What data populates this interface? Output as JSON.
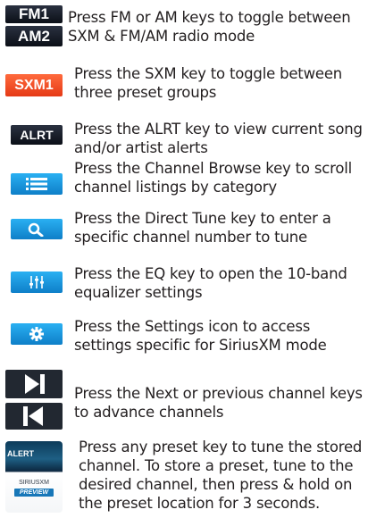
{
  "rows": [
    {
      "text": "Press FM or AM keys to toggle between SXM & FM/AM radio mode",
      "keys": [
        "FM1",
        "AM2"
      ]
    },
    {
      "text": "Press the SXM key to toggle between three preset groups",
      "keys": [
        "SXM1"
      ]
    },
    {
      "text": "Press the ALRT key to view current song and/or artist alerts",
      "keys": [
        "ALRT"
      ]
    },
    {
      "text": "Press the Channel Browse key to scroll channel listings by category",
      "icon": "list-icon"
    },
    {
      "text": "Press the Direct Tune key to enter a specific channel number to tune",
      "icon": "search-icon"
    },
    {
      "text": "Press the EQ key to open the 10-band equalizer settings",
      "icon": "equalizer-icon"
    },
    {
      "text": "Press the Settings icon to access settings specific for SiriusXM mode",
      "icon": "gear-icon"
    },
    {
      "text": "Press the Next or previous channel keys to advance channels",
      "icons": [
        "next-track-icon",
        "previous-track-icon"
      ]
    },
    {
      "text": "Press any preset key to tune the stored channel. To store a preset, tune to the desired channel, then press & hold on the preset location for 3 seconds.",
      "preset_labels": [
        "ALERT",
        "SIRIUSXM",
        "PREVIEW"
      ]
    }
  ]
}
